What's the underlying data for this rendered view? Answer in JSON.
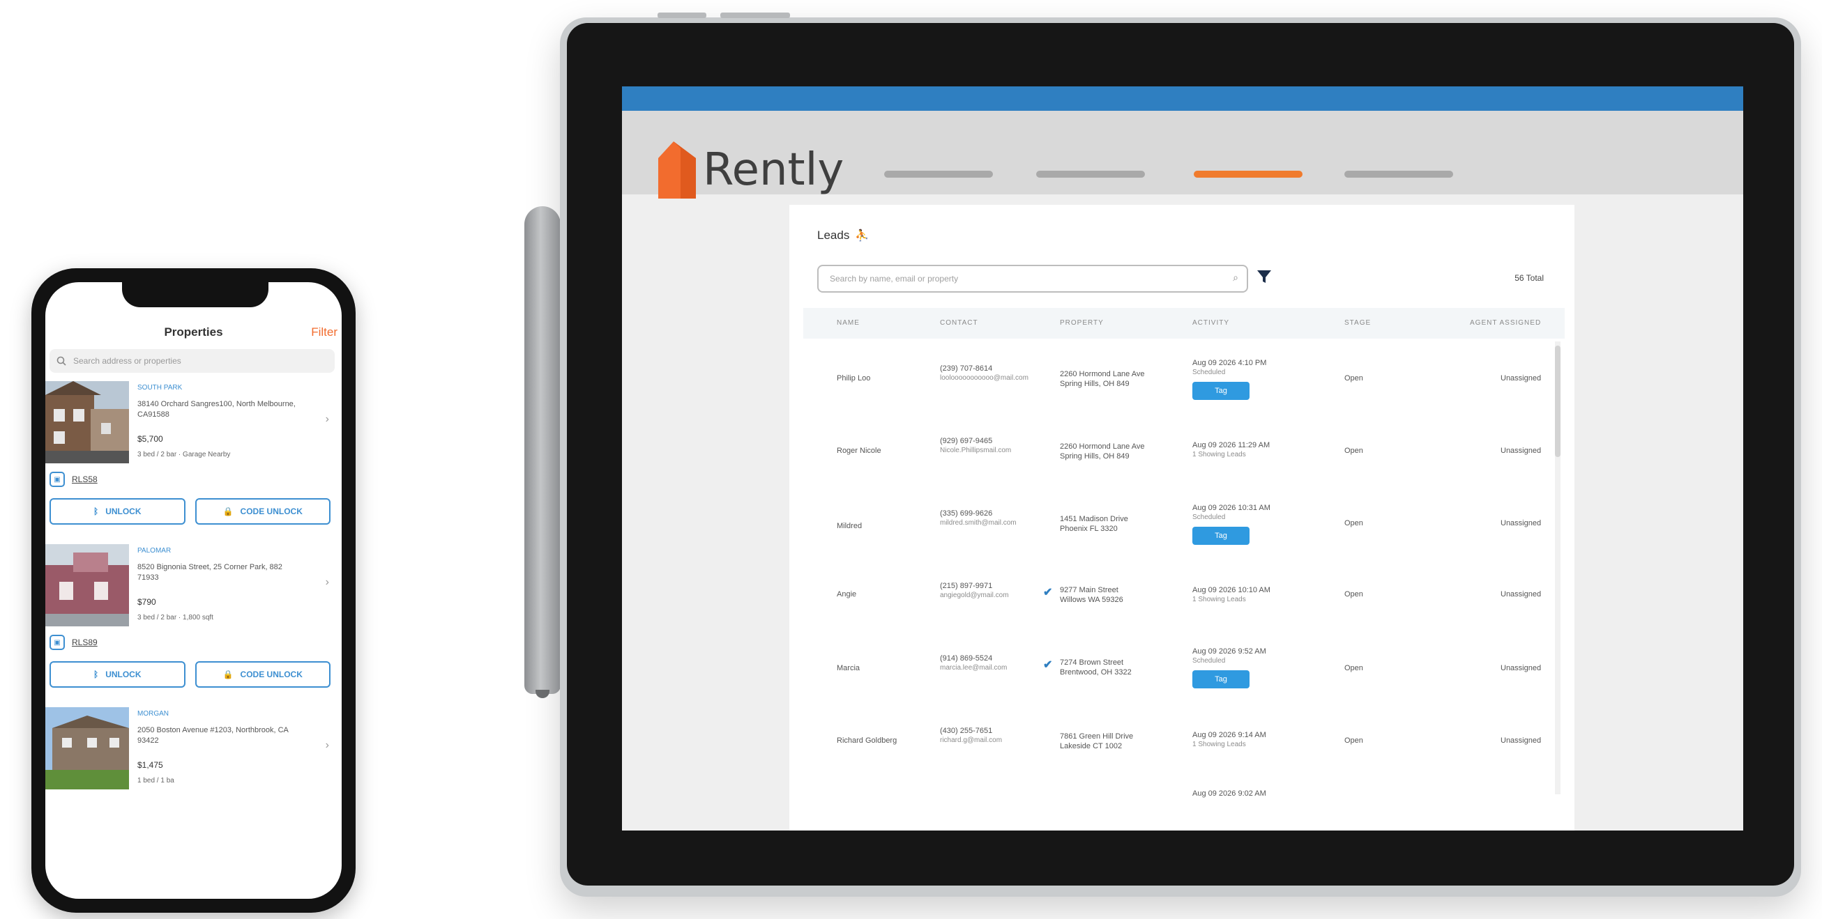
{
  "phone": {
    "title": "Properties",
    "filter": "Filter",
    "search_placeholder": "Search address or properties",
    "properties": [
      {
        "tag": "SOUTH PARK",
        "address": "38140 Orchard Sangres100, North Melbourne, CA91588",
        "price": "$5,700",
        "info": "3 bed / 2 bar · Garage Nearby",
        "lockbox": "RLS58",
        "unlock": "UNLOCK",
        "code_unlock": "CODE UNLOCK"
      },
      {
        "tag": "PALOMAR",
        "address": "8520 Bignonia Street, 25 Corner Park, 882 71933",
        "price": "$790",
        "info": "3 bed / 2 bar · 1,800 sqft",
        "lockbox": "RLS89",
        "unlock": "UNLOCK",
        "code_unlock": "CODE UNLOCK"
      },
      {
        "tag": "MORGAN",
        "address": "2050 Boston Avenue #1203, Northbrook, CA 93422",
        "price": "$1,475",
        "info": "1 bed / 1 ba"
      }
    ]
  },
  "tablet": {
    "logo": "Rently",
    "leads_title": "Leads",
    "search_placeholder": "Search by name, email or property",
    "total": "56 Total",
    "columns": [
      "NAME",
      "CONTACT",
      "PROPERTY",
      "ACTIVITY",
      "STAGE",
      "AGENT ASSIGNED"
    ],
    "rows": [
      {
        "name": "Philip Loo",
        "contact": "(239) 707-8614",
        "contact_sub": "loolooooooooooo@mail.com",
        "property": "2260 Hormond Lane Ave",
        "property_sub": "Spring Hills, OH 849",
        "activity": "Aug 09 2026 4:10 PM",
        "activity_sub": "Scheduled",
        "pill": "Tag",
        "stage": "Open",
        "agent": "Unassigned"
      },
      {
        "name": "Roger Nicole",
        "contact": "(929) 697-9465",
        "contact_sub": "Nicole.Phillipsmail.com",
        "property": "2260 Hormond Lane Ave",
        "property_sub": "Spring Hills, OH 849",
        "activity": "Aug 09 2026 11:29 AM",
        "activity_sub": "1 Showing Leads",
        "stage": "Open",
        "agent": "Unassigned"
      },
      {
        "name": "Mildred",
        "contact": "(335) 699-9626",
        "contact_sub": "mildred.smith@mail.com",
        "property": "1451 Madison Drive",
        "property_sub": "Phoenix FL 3320",
        "activity": "Aug 09 2026 10:31 AM",
        "activity_sub": "Scheduled",
        "pill": "Tag",
        "stage": "Open",
        "agent": "Unassigned"
      },
      {
        "name": "Angie",
        "contact": "(215) 897-9971",
        "contact_sub": "angiegold@ymail.com",
        "property": "9277 Main Street",
        "property_sub": "Willows WA 59326",
        "activity": "Aug 09 2026 10:10 AM",
        "activity_sub": "1 Showing Leads",
        "checked": "✔",
        "stage": "Open",
        "agent": "Unassigned"
      },
      {
        "name": "Marcia",
        "contact": "(914) 869-5524",
        "contact_sub": "marcia.lee@mail.com",
        "property": "7274 Brown Street",
        "property_sub": "Brentwood, OH 3322",
        "activity": "Aug 09 2026 9:52 AM",
        "activity_sub": "Scheduled",
        "checked": "✔",
        "pill": "Tag",
        "stage": "Open",
        "agent": "Unassigned"
      },
      {
        "name": "Richard Goldberg",
        "contact": "(430) 255-7651",
        "contact_sub": "richard.g@mail.com",
        "property": "7861 Green Hill Drive",
        "property_sub": "Lakeside CT 1002",
        "activity": "Aug 09 2026 9:14 AM",
        "activity_sub": "1 Showing Leads",
        "stage": "Open",
        "agent": "Unassigned"
      },
      {
        "activity": "Aug 09 2026 9:02 AM"
      }
    ]
  },
  "colors": {
    "brand_orange": "#f26c2e",
    "brand_blue": "#2f7fc1",
    "pill_blue": "#2f9ae0"
  }
}
